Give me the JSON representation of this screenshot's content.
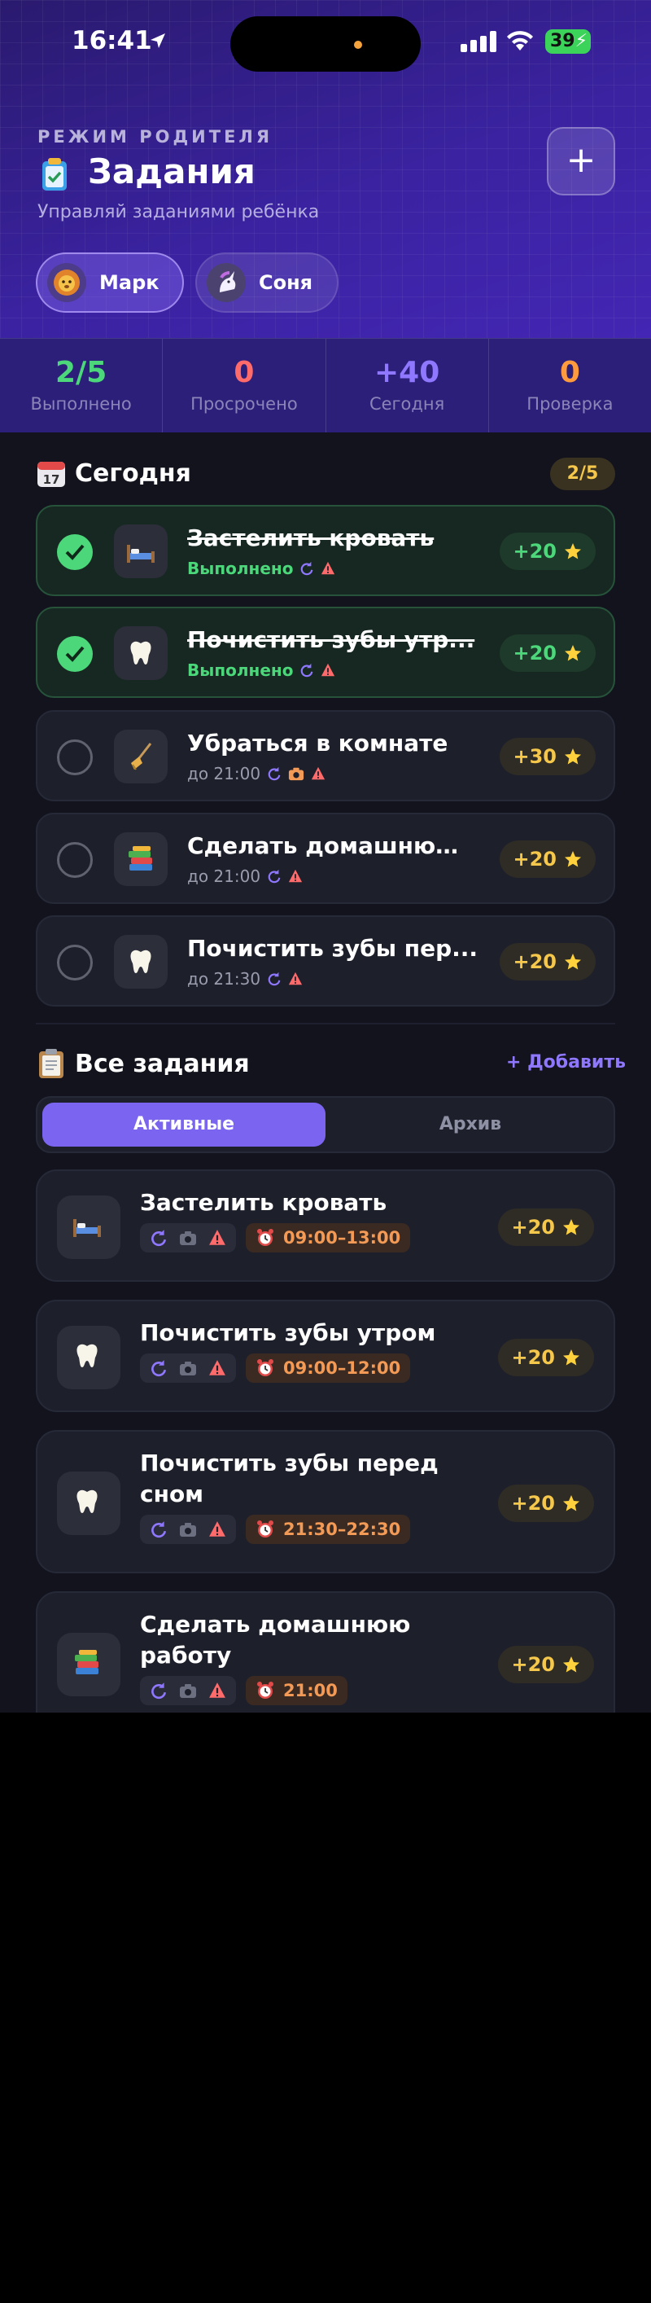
{
  "status_bar": {
    "time": "16:41",
    "battery": "39"
  },
  "header": {
    "mode_label": "РЕЖИМ РОДИТЕЛЯ",
    "title": "Задания",
    "subtitle": "Управляй заданиями ребёнка",
    "add_button": "+"
  },
  "children": [
    {
      "name": "Марк",
      "avatar_icon": "lion-icon",
      "selected": true
    },
    {
      "name": "Соня",
      "avatar_icon": "unicorn-icon",
      "selected": false
    }
  ],
  "stats": [
    {
      "value": "2/5",
      "label": "Выполнено",
      "color": "#4cd77b"
    },
    {
      "value": "0",
      "label": "Просрочено",
      "color": "#ff6b6b"
    },
    {
      "value": "+40",
      "label": "Сегодня",
      "color": "#8f78ff"
    },
    {
      "value": "0",
      "label": "Проверка",
      "color": "#ff9a3d"
    }
  ],
  "today": {
    "title": "Сегодня",
    "badge": "2/5",
    "tasks": [
      {
        "name": "Застелить кровать",
        "sub": "Выполнено",
        "points": "+20",
        "done": true,
        "icon": "bed-icon"
      },
      {
        "name": "Почистить зубы утр...",
        "sub": "Выполнено",
        "points": "+20",
        "done": true,
        "icon": "tooth-icon"
      },
      {
        "name": "Убраться в комнате",
        "sub": "до 21:00",
        "points": "+30",
        "done": false,
        "icon": "broom-icon"
      },
      {
        "name": "Сделать домашнюю...",
        "sub": "до 21:00",
        "points": "+20",
        "done": false,
        "icon": "books-icon"
      },
      {
        "name": "Почистить зубы пер...",
        "sub": "до 21:30",
        "points": "+20",
        "done": false,
        "icon": "tooth-icon"
      }
    ]
  },
  "all_tasks": {
    "title": "Все задания",
    "add_label": "+ Добавить",
    "tabs": [
      "Активные",
      "Архив"
    ],
    "items": [
      {
        "name": "Застелить кровать",
        "time": "09:00–13:00",
        "points": "+20",
        "icon": "bed-icon"
      },
      {
        "name": "Почистить зубы утром",
        "time": "09:00–12:00",
        "points": "+20",
        "icon": "tooth-icon"
      },
      {
        "name": "Почистить зубы перед сном",
        "time": "21:30–22:30",
        "points": "+20",
        "icon": "tooth-icon"
      },
      {
        "name": "Сделать домашнюю работу",
        "time": "21:00",
        "points": "+20",
        "icon": "books-icon"
      }
    ]
  }
}
